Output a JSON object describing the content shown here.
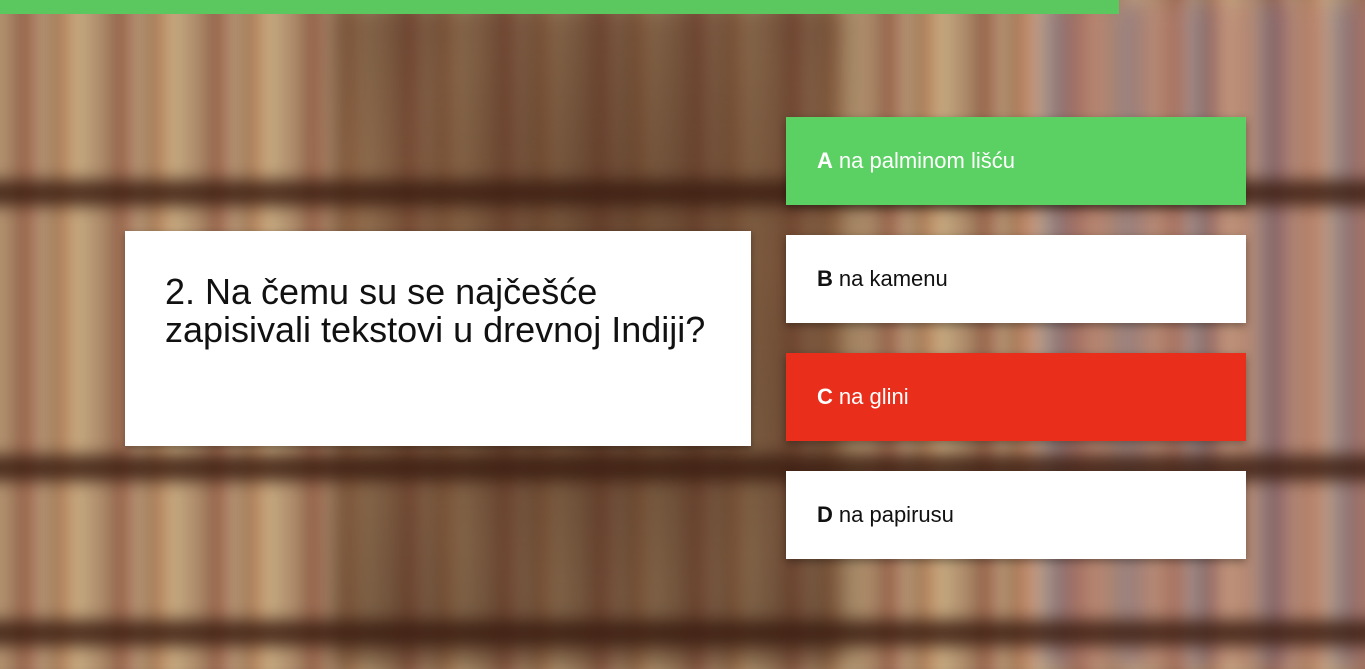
{
  "quiz": {
    "progress_fraction": 0.82,
    "question": {
      "text": "2. Na čemu su se najčešće zapisivali tekstovi u drevnoj Indiji?"
    },
    "answers": [
      {
        "letter": "A",
        "text": "na palminom lišću",
        "state": "correct"
      },
      {
        "letter": "B",
        "text": "na kamenu",
        "state": "neutral"
      },
      {
        "letter": "C",
        "text": "na glini",
        "state": "wrong"
      },
      {
        "letter": "D",
        "text": "na papirusu",
        "state": "neutral"
      }
    ]
  },
  "colors": {
    "progress": "#5ac85f",
    "correct": "#5ad162",
    "wrong": "#ea2e1c",
    "neutral": "#ffffff"
  },
  "icons": {
    "background": "library-bookshelf-image"
  }
}
